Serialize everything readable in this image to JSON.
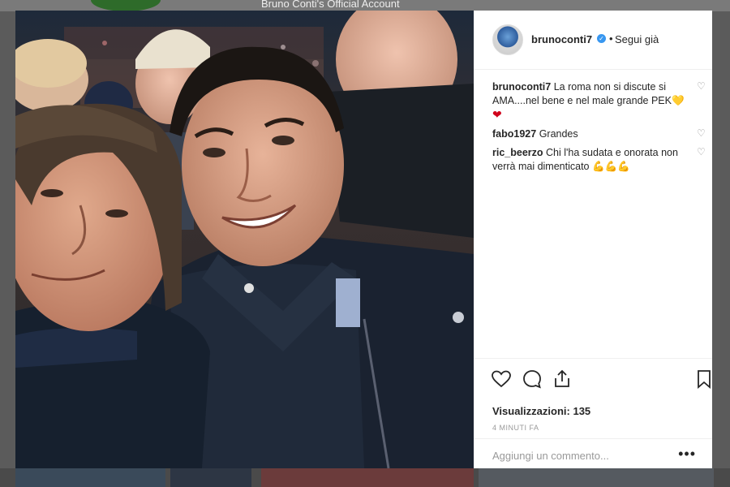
{
  "background": {
    "header_text": "Bruno Conti's Official Account"
  },
  "post": {
    "username": "brunoconti7",
    "verified_icon": "verified-badge-icon",
    "separator": "•",
    "follow_label": "Segui già",
    "comments": [
      {
        "user": "brunoconti7",
        "text": "La roma non si discute si AMA....nel bene e nel male grande PEK",
        "emoji": "💛",
        "emoji2": "❤"
      },
      {
        "user": "fabo1927",
        "text": "Grandes",
        "emoji": "",
        "emoji2": ""
      },
      {
        "user": "ric_beerzo",
        "text": "Chi l'ha sudata e onorata non verrà mai dimenticato",
        "emoji": "💪💪💪",
        "emoji2": ""
      }
    ],
    "views_label": "Visualizzazioni:",
    "views_count": "135",
    "time_ago": "4 MINUTI FA",
    "add_comment_placeholder": "Aggiungi un commento...",
    "more_label": "•••"
  },
  "colors": {
    "link_blue": "#3897f0",
    "text": "#262626",
    "muted": "#999999"
  }
}
